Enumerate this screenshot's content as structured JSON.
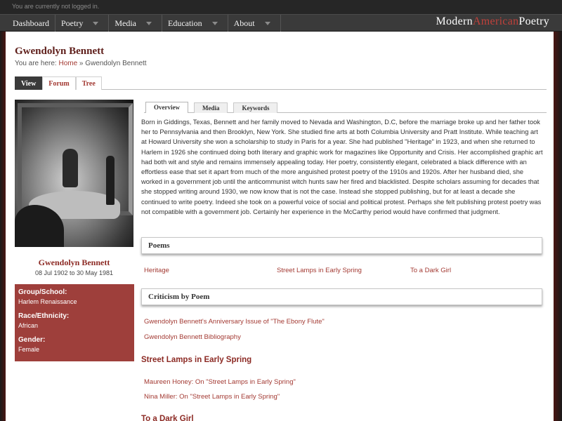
{
  "login_status": "You are currently not logged in.",
  "nav": {
    "items": [
      {
        "label": "Dashboard",
        "dropdown": false
      },
      {
        "label": "Poetry",
        "dropdown": true
      },
      {
        "label": "Media",
        "dropdown": true
      },
      {
        "label": "Education",
        "dropdown": true
      },
      {
        "label": "About",
        "dropdown": true
      }
    ],
    "brand": {
      "part1": "Modern",
      "part2": "American",
      "part3": "Poetry"
    }
  },
  "page": {
    "title": "Gwendolyn Bennett",
    "breadcrumb_prefix": "You are here: ",
    "breadcrumb_home": "Home",
    "breadcrumb_sep": " » ",
    "breadcrumb_current": "Gwendolyn Bennett"
  },
  "top_tabs": [
    "View",
    "Forum",
    "Tree"
  ],
  "sub_tabs": [
    "Overview",
    "Media",
    "Keywords"
  ],
  "person": {
    "name": "Gwendolyn Bennett",
    "dates": "08 Jul 1902 to 30 May 1981",
    "info": [
      {
        "label": "Group/School:",
        "value": "Harlem Renaissance"
      },
      {
        "label": "Race/Ethnicity:",
        "value": "African"
      },
      {
        "label": "Gender:",
        "value": "Female"
      }
    ]
  },
  "bio": "Born in Giddings, Texas, Bennett and her family moved to Nevada and Washington, D.C, before the marriage broke up and her father took her to Pennsylvania and then Brooklyn, New York. She studied fine arts at both Columbia University and Pratt Institute. While teaching art at Howard University she won a scholarship to study in Paris for a year. She had published \"Heritage\" in 1923, and when she returned to Harlem in 1926 she continued doing both literary and graphic work for magazines like Opportunity and Crisis. Her accomplished graphic art had both wit and style and remains immensely appealing today. Her poetry, consistently elegant, celebrated a black difference with an effortless ease that set it apart from much of the more anguished protest poetry of the 1910s and 1920s. After her husband died, she worked in a government job until the anticommunist witch hunts saw her fired and blacklisted. Despite scholars assuming for decades that she stopped writing around 1930, we now know that is not the case. Instead she stopped publishing, but for at least a decade she continued to write poetry. Indeed she took on a powerful voice of social and political protest. Perhaps she felt publishing protest poetry was not compatible with a government job. Certainly her experience in the McCarthy period would have confirmed that judgment.",
  "poems_section": {
    "heading": "Poems",
    "items": [
      "Heritage",
      "Street Lamps in Early Spring",
      "To a Dark Girl"
    ]
  },
  "criticism_section": {
    "heading": "Criticism by Poem",
    "general_items": [
      "Gwendolyn Bennett's Anniversary Issue of \"The Ebony Flute\"",
      "Gwendolyn Bennett Bibliography"
    ],
    "groups": [
      {
        "poem": "Street Lamps in Early Spring",
        "items": [
          "Maureen Honey: On \"Street Lamps in Early Spring\"",
          "Nina Miller: On \"Street Lamps in Early Spring\""
        ]
      },
      {
        "poem": "To a Dark Girl",
        "items": []
      }
    ]
  },
  "colors": {
    "accent": "#a33a33",
    "info_box": "#9e3f3b",
    "nav_bg": "#3a3a3a"
  }
}
